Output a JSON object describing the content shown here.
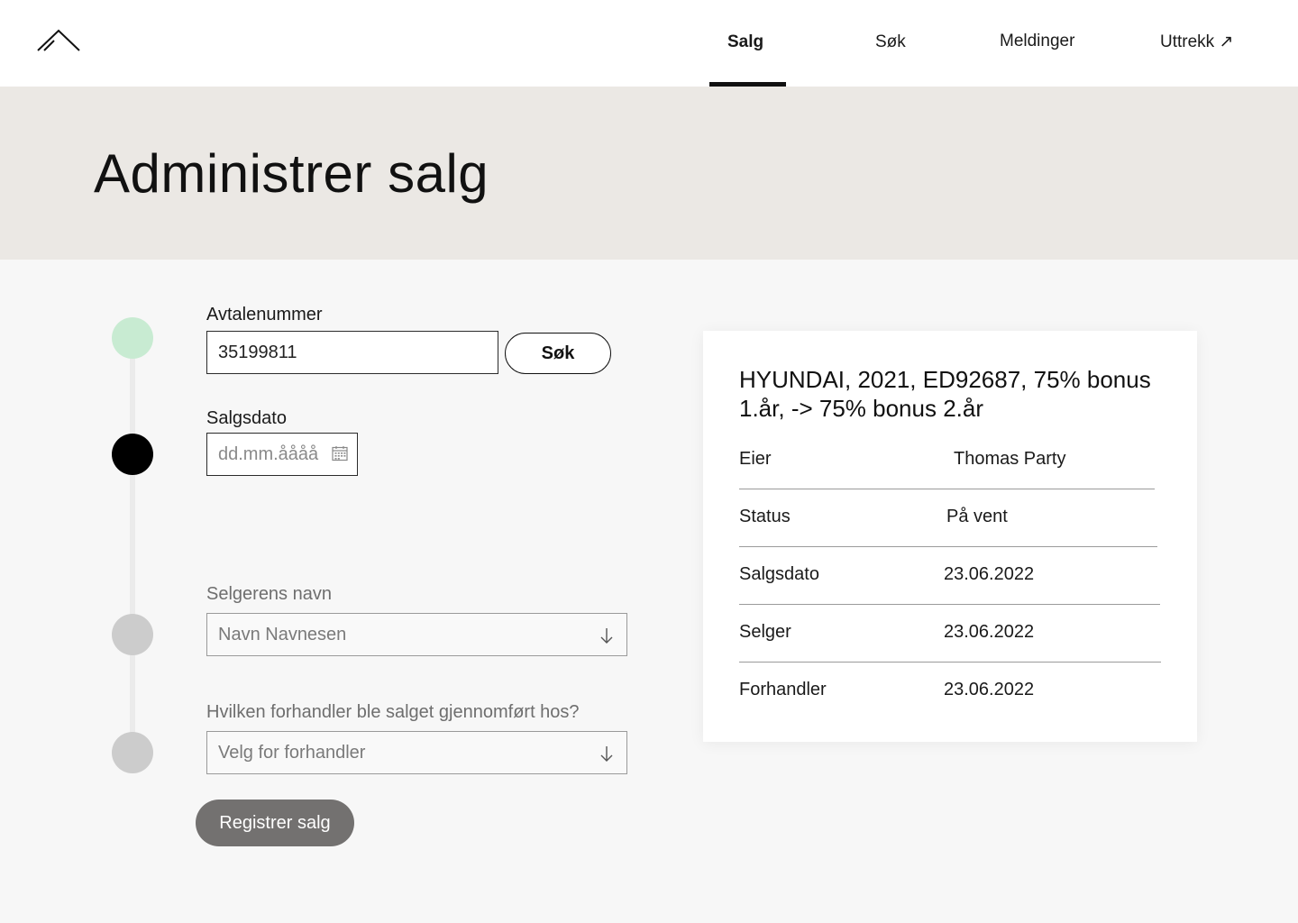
{
  "nav": {
    "items": [
      {
        "label": "Salg",
        "active": true
      },
      {
        "label": "Søk"
      },
      {
        "label": "Meldinger"
      },
      {
        "label": "Uttrekk ↗"
      }
    ]
  },
  "header": {
    "title": "Administrer salg"
  },
  "form": {
    "agreement": {
      "label": "Avtalenummer",
      "value": "35199811",
      "search_label": "Søk"
    },
    "sale_date": {
      "label": "Salgsdato",
      "placeholder": "dd.mm.åååå"
    },
    "seller": {
      "label": "Selgerens navn",
      "value": "Navn Navnesen"
    },
    "dealer": {
      "label": "Hvilken forhandler ble salget gjennomført hos?",
      "value": "Velg for forhandler"
    },
    "submit_label": "Registrer salg"
  },
  "steps": [
    {
      "state": "complete",
      "color": "#c8ebd2"
    },
    {
      "state": "current",
      "color": "#000000"
    },
    {
      "state": "inactive",
      "color": "#cccccc"
    },
    {
      "state": "inactive",
      "color": "#cccccc"
    }
  ],
  "summary": {
    "title": "HYUNDAI, 2021, ED92687, 75% bonus 1.år, -> 75% bonus 2.år",
    "rows": [
      {
        "key": "Eier",
        "value": "Thomas Party"
      },
      {
        "key": "Status",
        "value": "På vent"
      },
      {
        "key": "Salgsdato",
        "value": "23.06.2022"
      },
      {
        "key": "Selger",
        "value": "23.06.2022"
      },
      {
        "key": "Forhandler",
        "value": "23.06.2022"
      }
    ]
  },
  "colors": {
    "hero_bg": "#ebe8e4",
    "page_bg": "#f7f7f7",
    "step_complete": "#c8ebd2",
    "button_disabled": "#737170"
  }
}
